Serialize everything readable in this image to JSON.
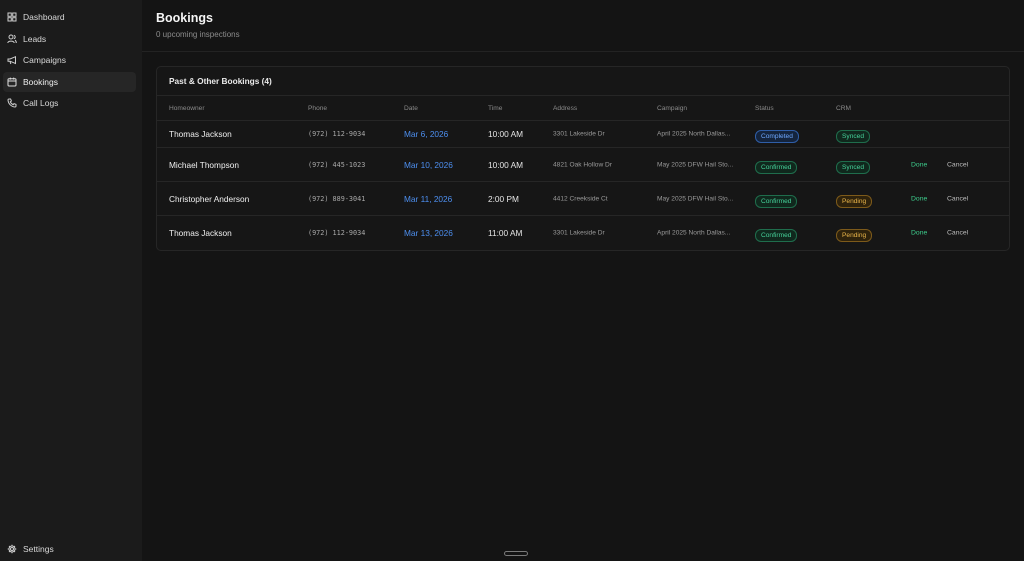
{
  "sidebar": {
    "items": [
      {
        "label": "Dashboard",
        "icon": "dashboard-icon"
      },
      {
        "label": "Leads",
        "icon": "users-icon"
      },
      {
        "label": "Campaigns",
        "icon": "megaphone-icon"
      },
      {
        "label": "Bookings",
        "icon": "calendar-icon",
        "active": true
      },
      {
        "label": "Call Logs",
        "icon": "phone-icon"
      }
    ],
    "settings_label": "Settings"
  },
  "header": {
    "title": "Bookings",
    "subtitle": "0 upcoming inspections"
  },
  "bookings": {
    "card_title": "Past & Other Bookings (4)",
    "columns": {
      "homeowner": "Homeowner",
      "phone": "Phone",
      "date": "Date",
      "time": "Time",
      "address": "Address",
      "campaign": "Campaign",
      "status": "Status",
      "crm": "CRM"
    },
    "rows": [
      {
        "homeowner": "Thomas Jackson",
        "phone": "(972) 112-9034",
        "date": "Mar 6, 2026",
        "time": "10:00 AM",
        "address": "3301 Lakeside Dr",
        "campaign": "April 2025 North Dallas...",
        "status": "Completed",
        "crm": "Synced",
        "done": "",
        "cancel": ""
      },
      {
        "homeowner": "Michael Thompson",
        "phone": "(972) 445-1023",
        "date": "Mar 10, 2026",
        "time": "10:00 AM",
        "address": "4821 Oak Hollow Dr",
        "campaign": "May 2025 DFW Hail Sto...",
        "status": "Confirmed",
        "crm": "Synced",
        "done": "Done",
        "cancel": "Cancel"
      },
      {
        "homeowner": "Christopher Anderson",
        "phone": "(972) 889-3041",
        "date": "Mar 11, 2026",
        "time": "2:00 PM",
        "address": "4412 Creekside Ct",
        "campaign": "May 2025 DFW Hail Sto...",
        "status": "Confirmed",
        "crm": "Pending",
        "done": "Done",
        "cancel": "Cancel"
      },
      {
        "homeowner": "Thomas Jackson",
        "phone": "(972) 112-9034",
        "date": "Mar 13, 2026",
        "time": "11:00 AM",
        "address": "3301 Lakeside Dr",
        "campaign": "April 2025 North Dallas...",
        "status": "Confirmed",
        "crm": "Pending",
        "done": "Done",
        "cancel": "Cancel"
      }
    ]
  },
  "colors": {
    "background": "#141414",
    "sidebar": "#1b1b1b",
    "accent_blue": "#4d8ff0",
    "success_green": "#46d19a",
    "pending_amber": "#eab54a"
  }
}
